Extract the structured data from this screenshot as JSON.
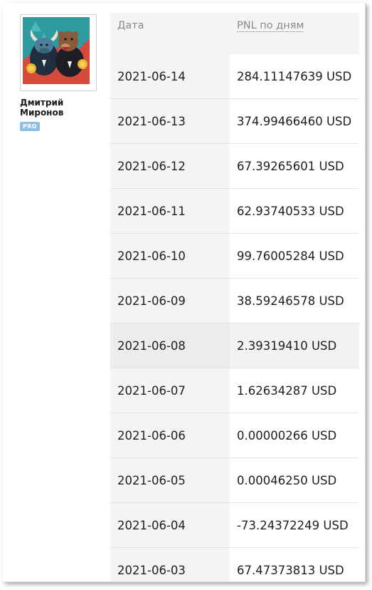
{
  "profile": {
    "name": "Дмитрий\nМиронов",
    "badge": "PRO",
    "avatar_icon": "bull-and-bear-avatar-icon"
  },
  "table": {
    "headers": {
      "date": "Дата",
      "pnl": "PNL по дням"
    },
    "rows": [
      {
        "date": "2021-06-14",
        "pnl": "284.11147639 USD"
      },
      {
        "date": "2021-06-13",
        "pnl": "374.99466460 USD"
      },
      {
        "date": "2021-06-12",
        "pnl": "67.39265601 USD"
      },
      {
        "date": "2021-06-11",
        "pnl": "62.93740533 USD"
      },
      {
        "date": "2021-06-10",
        "pnl": "99.76005284 USD"
      },
      {
        "date": "2021-06-09",
        "pnl": "38.59246578 USD"
      },
      {
        "date": "2021-06-08",
        "pnl": "2.39319410 USD"
      },
      {
        "date": "2021-06-07",
        "pnl": "1.62634287 USD"
      },
      {
        "date": "2021-06-06",
        "pnl": "0.00000266 USD"
      },
      {
        "date": "2021-06-05",
        "pnl": "0.00046250 USD"
      },
      {
        "date": "2021-06-04",
        "pnl": "-73.24372249 USD"
      },
      {
        "date": "2021-06-03",
        "pnl": "67.47373813 USD"
      }
    ],
    "highlighted_row": "2021-06-08"
  },
  "colors": {
    "badge": "#8ec0e6",
    "header_bg": "#f4f4f4",
    "date_col_bg": "#f4f4f4",
    "text": "#1f1f1f",
    "header_text": "#8a8a8a"
  }
}
